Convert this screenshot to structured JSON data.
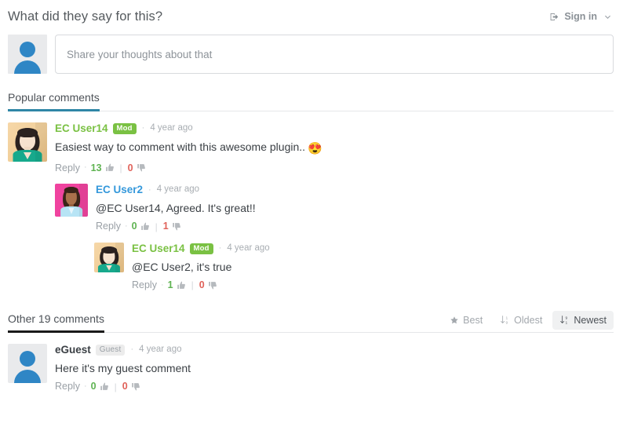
{
  "header": {
    "title": "What did they say for this?",
    "signin_label": "Sign in",
    "signin_icon": "sign-in-arrow-icon",
    "chevron_icon": "chevron-down-icon"
  },
  "composer": {
    "placeholder": "Share your thoughts about that",
    "value": "",
    "avatar_icon": "default-user-avatar"
  },
  "popular_section": {
    "tab_label": "Popular comments",
    "accent_color": "#2f86a6",
    "comments": [
      {
        "author": "EC User14",
        "author_color": "#7ac143",
        "badge": "Mod",
        "badge_color": "#7ac143",
        "time": "4 year ago",
        "text": "Easiest way to comment with this awesome plugin..",
        "emoji": "😍",
        "reply_label": "Reply",
        "upvotes": "13",
        "downvotes": "0",
        "level": 1,
        "avatar": "female-dark-hair-teal-shirt"
      },
      {
        "author": "EC User2",
        "author_color": "#3498db",
        "badge": "",
        "time": "4 year ago",
        "text": "@EC User14, Agreed. It's great!!",
        "emoji": "",
        "reply_label": "Reply",
        "upvotes": "0",
        "downvotes": "1",
        "level": 2,
        "avatar": "female-pink-background"
      },
      {
        "author": "EC User14",
        "author_color": "#7ac143",
        "badge": "Mod",
        "badge_color": "#7ac143",
        "time": "4 year ago",
        "text": "@EC User2, it's true",
        "emoji": "",
        "reply_label": "Reply",
        "upvotes": "1",
        "downvotes": "0",
        "level": 3,
        "avatar": "female-dark-hair-teal-shirt"
      }
    ]
  },
  "other_section": {
    "tab_label": "Other 19 comments",
    "accent_color": "#1a1a1a",
    "sorts": [
      {
        "label": "Best",
        "icon": "star-icon",
        "active": false
      },
      {
        "label": "Oldest",
        "icon": "sort-numeric-asc-icon",
        "active": false
      },
      {
        "label": "Newest",
        "icon": "sort-numeric-desc-icon",
        "active": true
      }
    ],
    "comments": [
      {
        "author": "eGuest",
        "author_color": "#3b4045",
        "badge": "Guest",
        "time": "4 year ago",
        "text": "Here it's my guest comment",
        "emoji": "",
        "reply_label": "Reply",
        "upvotes": "0",
        "downvotes": "0",
        "level": 1,
        "avatar": "default-user-avatar"
      }
    ]
  },
  "icons": {
    "thumb_up": "thumbs-up-icon",
    "thumb_down": "thumbs-down-icon"
  }
}
